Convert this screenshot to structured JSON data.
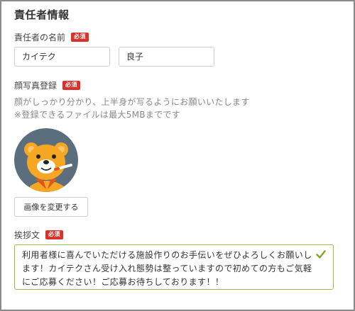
{
  "section": {
    "title": "責任者情報"
  },
  "name": {
    "label": "責任者の名前",
    "required_badge": "必須",
    "last_name_value": "カイテク",
    "first_name_value": "良子"
  },
  "photo": {
    "label": "顔写真登録",
    "required_badge": "必須",
    "hint_line1": "顔がしっかり分かり、上半身が写るようにお願いいたします",
    "hint_line2": "※登録できるファイルは最大5MBまでです",
    "avatar_icon": "bear-mascot-icon",
    "change_button": "画像を変更する"
  },
  "greeting": {
    "label": "挨拶文",
    "required_badge": "必須",
    "value": "利用者様に喜んでいただける施設作りのお手伝いをぜひよろしくお願いします！カイテクさん受け入れ態勢は整っていますので初めての方もご気軽にご応募ください！ご応募お待ちしております！！",
    "valid_icon": "checkmark-icon"
  },
  "colors": {
    "required_badge": "#d9322b",
    "valid_border": "#9dbb44",
    "valid_check": "#7fa62a",
    "avatar_bg": "#5b6e7e",
    "bear": "#f5a623"
  }
}
